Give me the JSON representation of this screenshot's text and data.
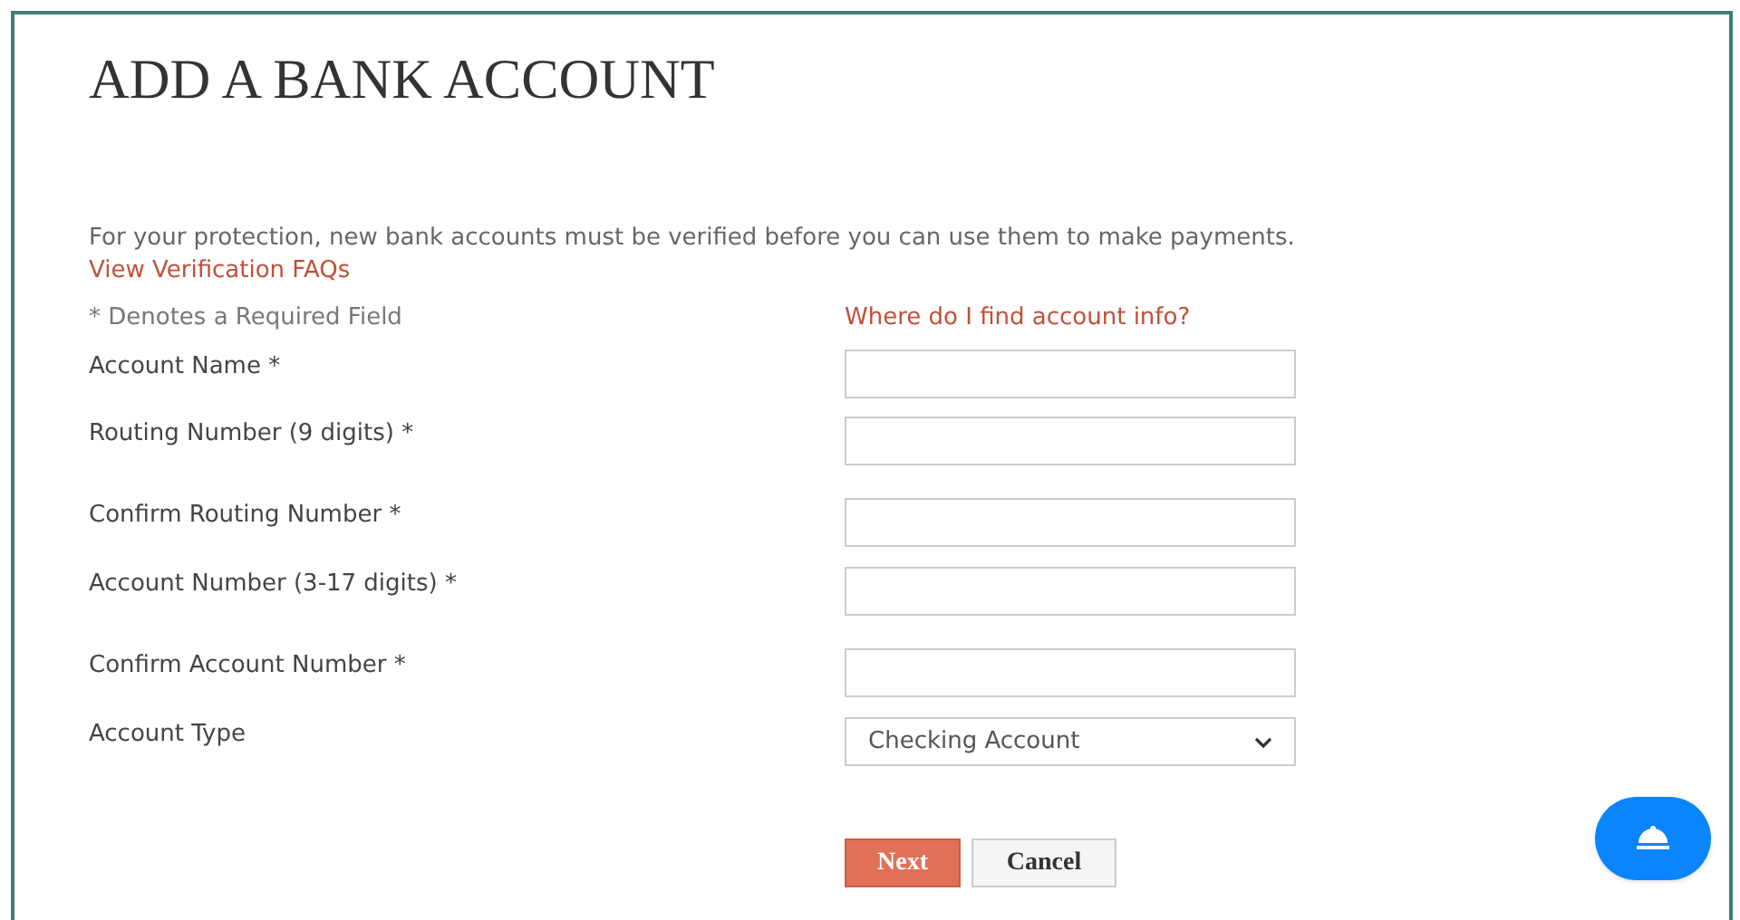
{
  "title": "ADD A BANK ACCOUNT",
  "intro": "For your protection, new bank accounts must be verified before you can use them to make payments.",
  "faq_link": "View Verification FAQs",
  "required_note": "* Denotes a Required Field",
  "help_link": "Where do I find account info?",
  "fields": [
    {
      "label": "Account Name *",
      "kind": "text"
    },
    {
      "label": "Routing Number (9 digits) *",
      "kind": "text"
    },
    {
      "label": "Confirm Routing Number *",
      "kind": "text"
    },
    {
      "label": "Account Number (3-17 digits) *",
      "kind": "text"
    },
    {
      "label": "Confirm Account Number *",
      "kind": "text"
    },
    {
      "label": "Account Type",
      "kind": "select",
      "value": "Checking Account"
    }
  ],
  "buttons": [
    {
      "label": "Next",
      "kind": "primary"
    },
    {
      "label": "Cancel",
      "kind": "secondary"
    }
  ]
}
